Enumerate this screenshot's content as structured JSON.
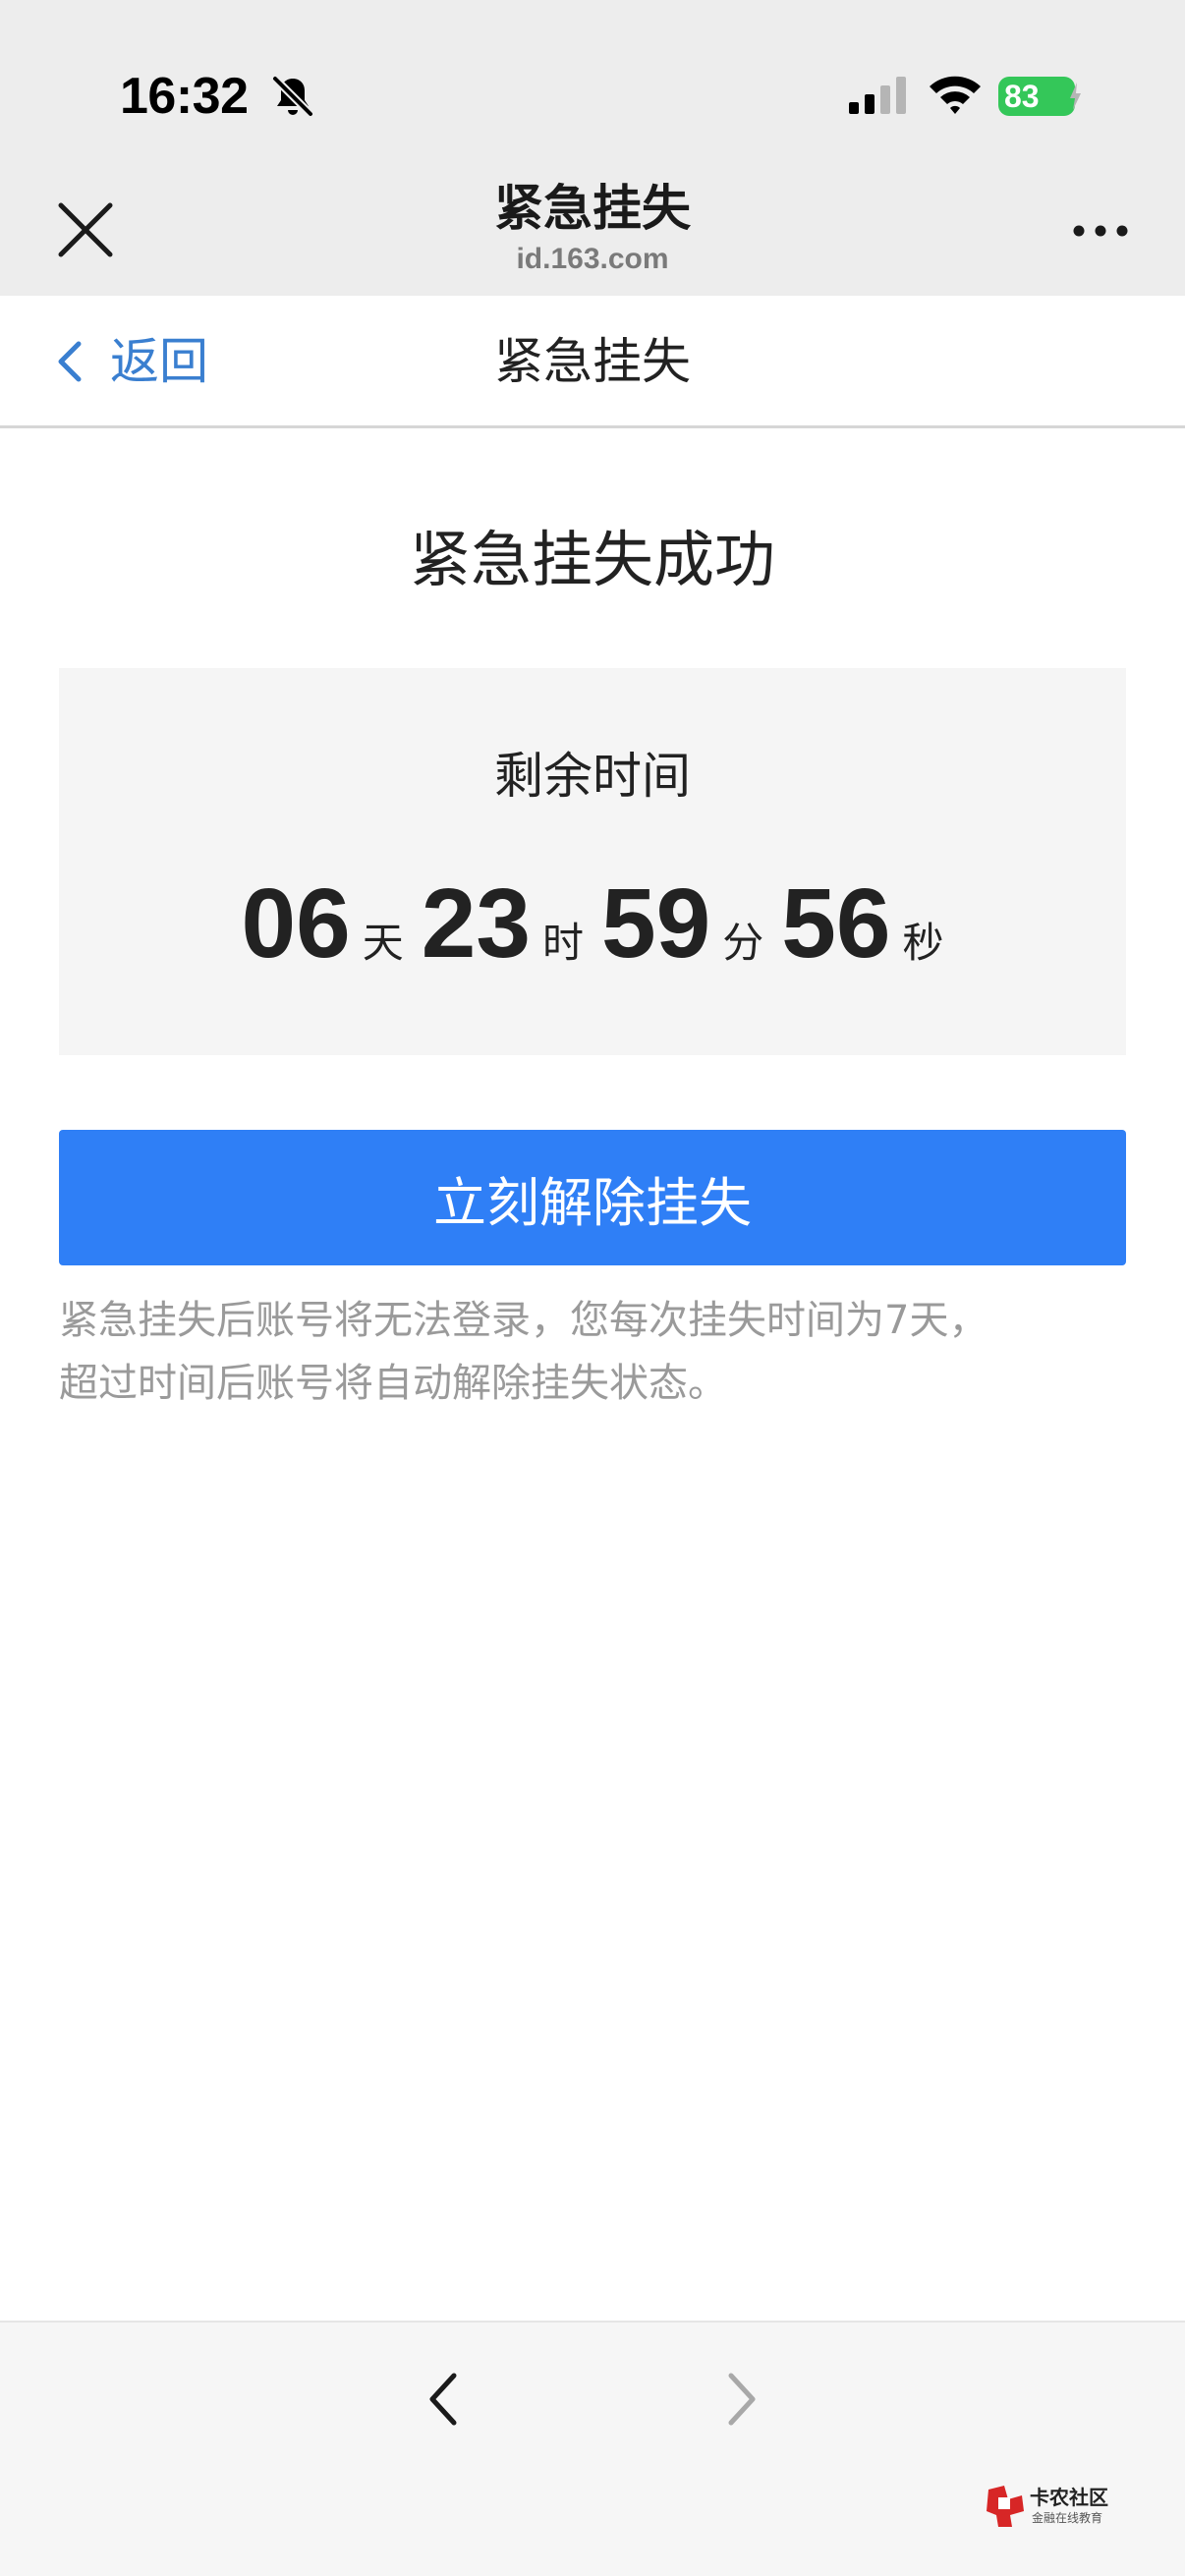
{
  "status_bar": {
    "time": "16:32",
    "battery": "83",
    "icons": [
      "bell-slash-icon",
      "cellular-signal-icon",
      "wifi-icon",
      "battery-charging-icon"
    ]
  },
  "browser_chrome": {
    "title": "紧急挂失",
    "url": "id.163.com",
    "icons": [
      "close-icon",
      "more-icon"
    ]
  },
  "navbar": {
    "back_label": "返回",
    "title": "紧急挂失"
  },
  "main": {
    "heading": "紧急挂失成功",
    "timer": {
      "label": "剩余时间",
      "days": "06",
      "days_unit": "天",
      "hours": "23",
      "hours_unit": "时",
      "minutes": "59",
      "minutes_unit": "分",
      "seconds": "56",
      "seconds_unit": "秒"
    },
    "primary_button": "立刻解除挂失",
    "notice_line1": "紧急挂失后账号将无法登录，您每次挂失时间为7天，",
    "notice_line2": "超过时间后账号将自动解除挂失状态。"
  },
  "bottom_bar": {
    "icons": [
      "back-arrow-icon",
      "forward-arrow-icon"
    ]
  },
  "watermark": {
    "title": "卡农社区",
    "subtitle": "金融在线教育"
  },
  "colors": {
    "accent": "#2f7ff6",
    "link": "#3a7fd0",
    "battery": "#34c759",
    "chrome_bg": "#ededed",
    "card_bg": "#f5f5f5"
  }
}
